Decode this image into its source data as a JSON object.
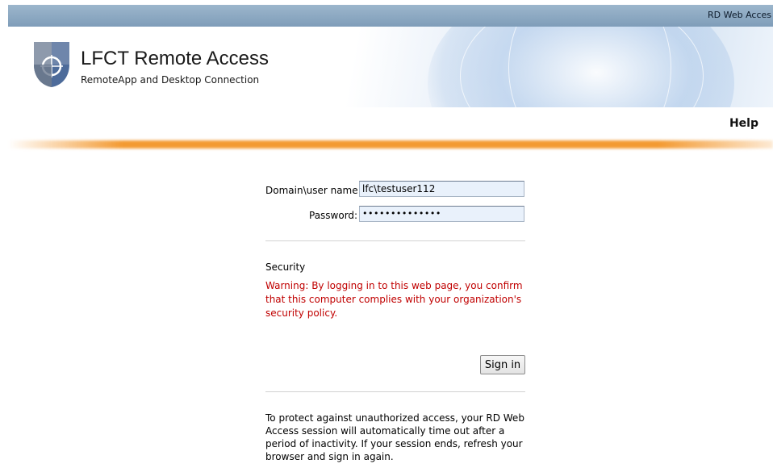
{
  "topbar": {
    "product_label": "RD Web Acces"
  },
  "header": {
    "title": "LFCT Remote Access",
    "subtitle": "RemoteApp and Desktop Connection",
    "help_link": "Help"
  },
  "login": {
    "username_label": "Domain\\user name:",
    "username_value": "lfc\\testuser112",
    "password_label": "Password:",
    "password_value": "••••••••••••••"
  },
  "security": {
    "heading": "Security",
    "warning": "Warning: By logging in to this web page, you confirm that this computer complies with your organization's security policy."
  },
  "signin_button": "Sign in",
  "timeout_notice": "To protect against unauthorized access, your RD Web Access session will automatically time out after a period of inactivity. If your session ends, refresh your browser and sign in again.",
  "colors": {
    "topbar": "#7f9db9",
    "accent_orange": "#f39a32",
    "warning_red": "#c00000",
    "input_bg": "#e9f1fb"
  },
  "icons": {
    "logo": "rd-web-access-shield-logo"
  }
}
